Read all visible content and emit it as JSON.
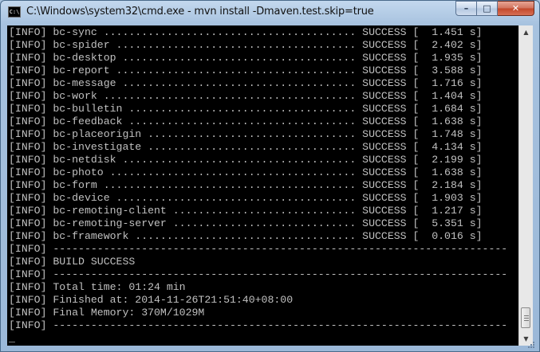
{
  "window": {
    "title": "C:\\Windows\\system32\\cmd.exe - mvn  install -Dmaven.test.skip=true",
    "icon_label": "C:\\",
    "buttons": {
      "minimize": "–",
      "maximize": "□",
      "close": "✕"
    }
  },
  "console": {
    "lines": [
      "[INFO] bc-sync ........................................ SUCCESS [  1.451 s]",
      "[INFO] bc-spider ...................................... SUCCESS [  2.402 s]",
      "[INFO] bc-desktop ..................................... SUCCESS [  1.935 s]",
      "[INFO] bc-report ...................................... SUCCESS [  3.588 s]",
      "[INFO] bc-message ..................................... SUCCESS [  1.716 s]",
      "[INFO] bc-work ........................................ SUCCESS [  1.404 s]",
      "[INFO] bc-bulletin .................................... SUCCESS [  1.684 s]",
      "[INFO] bc-feedback .................................... SUCCESS [  1.638 s]",
      "[INFO] bc-placeorigin ................................. SUCCESS [  1.748 s]",
      "[INFO] bc-investigate ................................. SUCCESS [  4.134 s]",
      "[INFO] bc-netdisk ..................................... SUCCESS [  2.199 s]",
      "[INFO] bc-photo ....................................... SUCCESS [  1.638 s]",
      "[INFO] bc-form ........................................ SUCCESS [  2.184 s]",
      "[INFO] bc-device ...................................... SUCCESS [  1.903 s]",
      "[INFO] bc-remoting-client ............................. SUCCESS [  1.217 s]",
      "[INFO] bc-remoting-server ............................. SUCCESS [  5.351 s]",
      "[INFO] bc-framework ................................... SUCCESS [  0.016 s]",
      "[INFO] ------------------------------------------------------------------------",
      "[INFO] BUILD SUCCESS",
      "[INFO] ------------------------------------------------------------------------",
      "[INFO] Total time: 01:24 min",
      "[INFO] Finished at: 2014-11-26T21:51:40+08:00",
      "[INFO] Final Memory: 370M/1029M",
      "[INFO] ------------------------------------------------------------------------",
      "_"
    ]
  },
  "scrollbar": {
    "up_arrow": "▲",
    "down_arrow": "▼"
  },
  "colors": {
    "console_bg": "#000000",
    "console_text": "#c0c0c0",
    "frame": "#a9c4e0",
    "close_button": "#c2472a"
  }
}
